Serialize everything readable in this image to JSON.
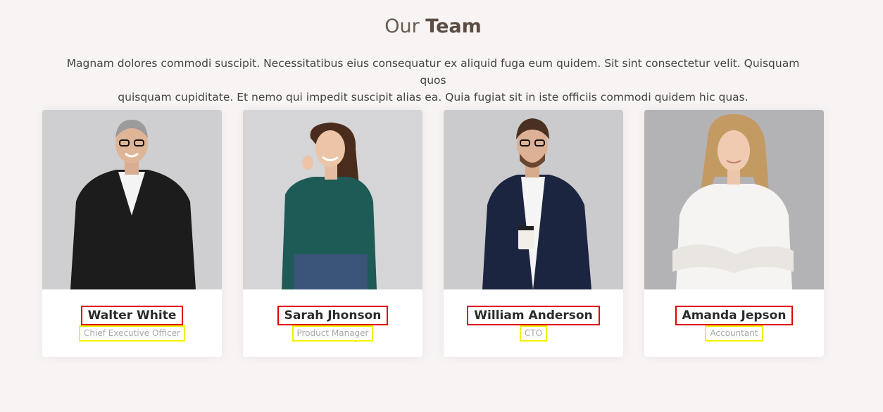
{
  "section": {
    "title_light": "Our",
    "title_bold": "Team",
    "description_line1": "Magnam dolores commodi suscipit. Necessitatibus eius consequatur ex aliquid fuga eum quidem. Sit sint consectetur velit. Quisquam quos",
    "description_line2": "quisquam cupiditate. Et nemo qui impedit suscipit alias ea. Quia fugiat sit in iste officiis commodi quidem hic quas."
  },
  "team": [
    {
      "name": "Walter White",
      "role": "Chief Executive Officer"
    },
    {
      "name": "Sarah Jhonson",
      "role": "Product Manager"
    },
    {
      "name": "William Anderson",
      "role": "CTO"
    },
    {
      "name": "Amanda Jepson",
      "role": "Accountant"
    }
  ],
  "colors": {
    "background": "#f7f4f3",
    "title": "#5c4c44",
    "name_highlight": "#e00000",
    "role_highlight": "#f2f200"
  }
}
